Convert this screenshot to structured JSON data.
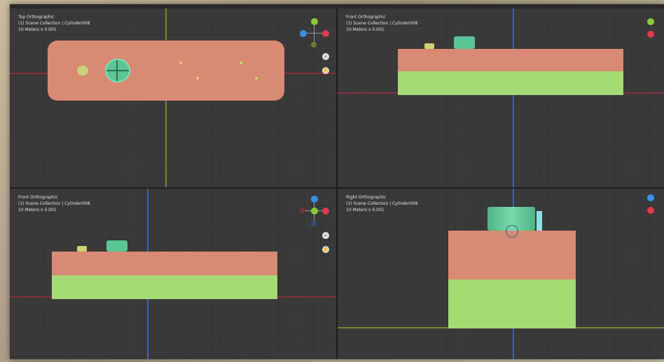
{
  "viewports": {
    "top_left": {
      "view_name": "Top Orthographic",
      "collection": "(1) Scene Collection | Cylinder008",
      "scale": "10 Meters x 0.001"
    },
    "top_right": {
      "view_name": "Front Orthographic",
      "collection": "(1) Scene Collection | Cylinder008",
      "scale": "10 Meters x 0.001"
    },
    "bottom_left": {
      "view_name": "Front Orthographic",
      "collection": "(1) Scene Collection | Cylinder008",
      "scale": "10 Meters x 0.001"
    },
    "bottom_right": {
      "view_name": "Right Orthographic",
      "collection": "(1) Scene Collection | Cylinder008",
      "scale": "10 Meters x 0.001"
    }
  },
  "gizmo": {
    "axis_colors": {
      "x": "#e0384e",
      "y": "#8ec63f",
      "z": "#3e8ee8"
    },
    "zoom_icon": "magnifier-icon",
    "pan_icon": "hand-icon"
  },
  "colors": {
    "top_block": "#d98a74",
    "bottom_block": "#a5da75",
    "cylinder": "#5cc595"
  }
}
